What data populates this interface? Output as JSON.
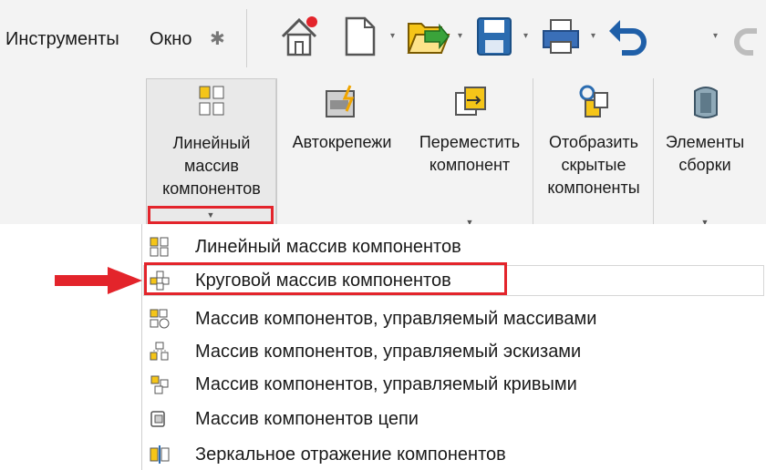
{
  "menu": {
    "tools": "Инструменты",
    "window": "Окно"
  },
  "toolbar": {
    "icons": [
      "home-icon",
      "new-document-icon",
      "open-icon",
      "save-icon",
      "print-icon",
      "undo-icon",
      "redo-icon"
    ]
  },
  "ribbon": {
    "linear_pattern": "Линейный\nмассив\nкомпонентов",
    "smart_fasteners": "Автокрепежи",
    "move_component": "Переместить\nкомпонент",
    "show_hidden": "Отобразить\nскрытые\nкомпоненты",
    "assembly_features": "Элементы\nсборки"
  },
  "dropdown": {
    "items": [
      "Линейный массив компонентов",
      "Круговой массив компонентов",
      "Массив компонентов, управляемый массивами",
      "Массив компонентов, управляемый эскизами",
      "Массив компонентов, управляемый кривыми",
      "Массив компонентов цепи",
      "Зеркальное отражение компонентов"
    ]
  },
  "colors": {
    "highlight_red": "#e3242b",
    "icon_yellow": "#f5c518",
    "icon_blue": "#2b6cb0"
  }
}
